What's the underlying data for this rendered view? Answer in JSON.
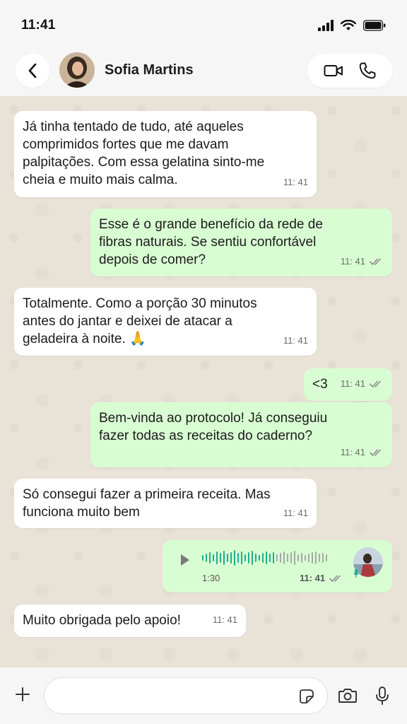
{
  "status": {
    "time": "11:41"
  },
  "header": {
    "contact_name": "Sofia Martins"
  },
  "messages": [
    {
      "dir": "in",
      "text": "Já tinha tentado de tudo, até aqueles\ncomprimidos fortes que me davam\npalpitações. Com essa gelatina sinto-me\ncheia e muito mais calma.",
      "time": "11: 41"
    },
    {
      "dir": "out",
      "text": "Esse é o grande benefício da rede de\nfibras naturais. Se sentiu confortável\ndepois de comer?",
      "time": "11: 41"
    },
    {
      "dir": "in",
      "text": "Totalmente. Como a porção 30 minutos\nantes do jantar e deixei de atacar a\ngeladeira à noite. 🙏",
      "time": "11: 41"
    },
    {
      "dir": "out",
      "text": "<3",
      "time": "11: 41"
    },
    {
      "dir": "out",
      "text": "Bem-vinda ao protocolo! Já conseguiu\nfazer todas as receitas do caderno?",
      "time": "11: 41"
    },
    {
      "dir": "in",
      "text": "Só consegui fazer a primeira receita. Mas\nfunciona muito bem",
      "time": "11: 41"
    },
    {
      "dir": "in",
      "text": "Muito obrigada pelo apoio!",
      "time": "11: 41"
    }
  ],
  "voice_note": {
    "duration": "1:30",
    "time": "11: 41",
    "progress": 0.0
  },
  "input": {
    "placeholder": ""
  },
  "colors": {
    "out_bubble": "#d9fdd3",
    "in_bubble": "#ffffff",
    "wave_active": "#1fae8f",
    "wave_idle": "#a7a7a7",
    "check": "#8a8a8a"
  }
}
